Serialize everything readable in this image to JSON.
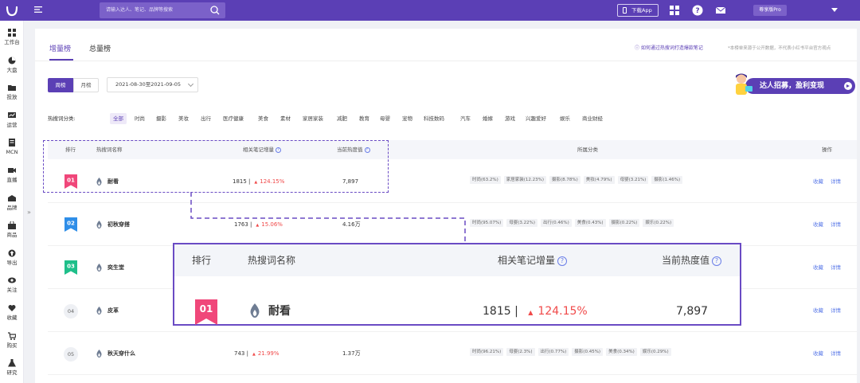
{
  "topbar": {
    "search_placeholder": "请输入达人、笔记、品牌等搜索",
    "download_app": "下载App",
    "user_plan": "尊享版Pro"
  },
  "sidebar": {
    "items": [
      {
        "label": "工作台",
        "icon": "grid-icon"
      },
      {
        "label": "大盘",
        "icon": "pie-icon"
      },
      {
        "label": "投放",
        "icon": "folder-icon"
      },
      {
        "label": "运营",
        "icon": "chart-icon"
      },
      {
        "label": "MCN",
        "icon": "document-icon"
      },
      {
        "label": "直播",
        "icon": "video-icon"
      },
      {
        "label": "品牌",
        "icon": "brand-icon"
      },
      {
        "label": "商品",
        "icon": "bag-icon"
      },
      {
        "label": "导出",
        "icon": "export-icon"
      },
      {
        "label": "关注",
        "icon": "eye-icon"
      },
      {
        "label": "收藏",
        "icon": "heart-icon"
      },
      {
        "label": "购买",
        "icon": "cart-icon"
      },
      {
        "label": "研究",
        "icon": "flask-icon"
      }
    ],
    "expand": "»"
  },
  "tabs": [
    "增量榜",
    "总量榜"
  ],
  "help_link": "如何通过热搜词打造爆款笔记",
  "note": "*本榜单来源于公开数据，不代表小红书平台官方观点",
  "period": {
    "week": "周榜",
    "month": "月榜"
  },
  "date_range": "2021-08-30至2021-09-05",
  "banner": {
    "text": "达人招募，盈利变现"
  },
  "categories": {
    "label": "热搜词分类:",
    "items": [
      "全部",
      "时尚",
      "摄影",
      "美妆",
      "出行",
      "医疗健康",
      "美食",
      "素材",
      "家居家装",
      "减肥",
      "教育",
      "母婴",
      "宠物",
      "科技数码",
      "汽车",
      "婚嫁",
      "游戏",
      "兴趣爱好",
      "娱乐",
      "商业财经"
    ]
  },
  "table": {
    "headers": {
      "rank": "排行",
      "keyword": "热搜词名称",
      "increment": "相关笔记增量",
      "heat": "当前热度值",
      "category": "所属分类",
      "action": "操作"
    },
    "actions": {
      "collect": "收藏",
      "detail": "详情"
    },
    "rows": [
      {
        "rank": "01",
        "keyword": "耐看",
        "count": "1815 |",
        "pct": "124.15%",
        "heat": "7,897",
        "tags": [
          "时尚(63.2%)",
          "家居家装(12.23%)",
          "摄影(8.78%)",
          "美妆(4.79%)",
          "母婴(3.21%)",
          "摄影(1.46%)"
        ]
      },
      {
        "rank": "02",
        "keyword": "初秋穿搭",
        "count": "1763 |",
        "pct": "15.06%",
        "heat": "4.16万",
        "tags": [
          "时尚(95.07%)",
          "母婴(3.22%)",
          "出行(0.46%)",
          "美食(0.43%)",
          "摄影(0.22%)",
          "娱乐(0.22%)"
        ]
      },
      {
        "rank": "03",
        "keyword": "奕生堂",
        "count": "",
        "pct": "",
        "heat": "",
        "tags": []
      },
      {
        "rank": "04",
        "keyword": "皮革",
        "count": "",
        "pct": "",
        "heat": "",
        "tags": []
      },
      {
        "rank": "05",
        "keyword": "秋天穿什么",
        "count": "743 |",
        "pct": "21.99%",
        "heat": "1.37万",
        "tags": [
          "时尚(96.21%)",
          "母婴(2.3%)",
          "出行(0.77%)",
          "摄影(0.45%)",
          "美食(0.34%)",
          "娱乐(0.29%)"
        ]
      }
    ]
  },
  "zoom": {
    "headers": {
      "rank": "排行",
      "keyword": "热搜词名称",
      "increment": "相关笔记增量",
      "heat": "当前热度值"
    },
    "row": {
      "rank": "01",
      "keyword": "耐看",
      "count": "1815 |",
      "pct": "124.15%",
      "heat": "7,897"
    }
  },
  "colors": {
    "brand": "#5b3fb5",
    "up": "#f04a4a",
    "link": "#5b7ae8",
    "rank1": "#f0477a",
    "rank2": "#2f8ee8",
    "rank3": "#1fbf8a"
  }
}
